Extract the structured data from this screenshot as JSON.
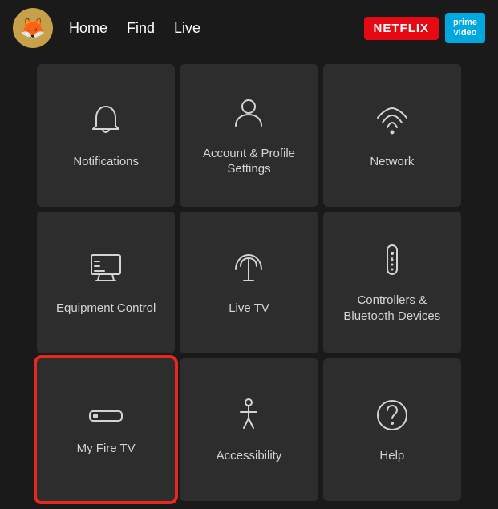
{
  "nav": {
    "logo_emoji": "🦊",
    "links": [
      "Home",
      "Find",
      "Live"
    ],
    "netflix_label": "NETFLIX",
    "prime_label": "prime\nvideo"
  },
  "grid": {
    "items": [
      {
        "id": "notifications",
        "label": "Notifications",
        "icon": "bell"
      },
      {
        "id": "account-profile",
        "label": "Account & Profile Settings",
        "icon": "person"
      },
      {
        "id": "network",
        "label": "Network",
        "icon": "wifi"
      },
      {
        "id": "equipment-control",
        "label": "Equipment Control",
        "icon": "monitor"
      },
      {
        "id": "live-tv",
        "label": "Live TV",
        "icon": "antenna"
      },
      {
        "id": "controllers-bluetooth",
        "label": "Controllers & Bluetooth Devices",
        "icon": "remote"
      },
      {
        "id": "my-fire-tv",
        "label": "My Fire TV",
        "icon": "firestick",
        "selected": true
      },
      {
        "id": "accessibility",
        "label": "Accessibility",
        "icon": "accessibility"
      },
      {
        "id": "help",
        "label": "Help",
        "icon": "help"
      }
    ]
  }
}
